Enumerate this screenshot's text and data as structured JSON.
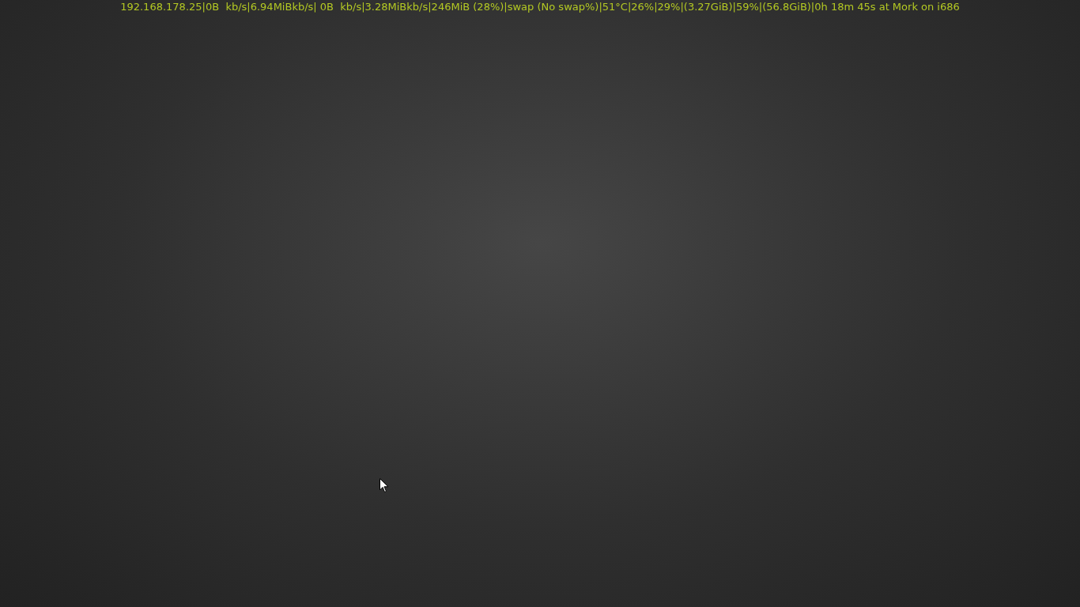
{
  "status_bar": {
    "text": "192.168.178.25|0B  kb/s|6.94MiBkb/s| 0B  kb/s|3.28MiBkb/s|246MiB (28%)|swap (No swap%)|51°C|26%|29%|(3.27GiB)|59%|(56.8GiB)|0h 18m 45s at Mork on i686"
  }
}
